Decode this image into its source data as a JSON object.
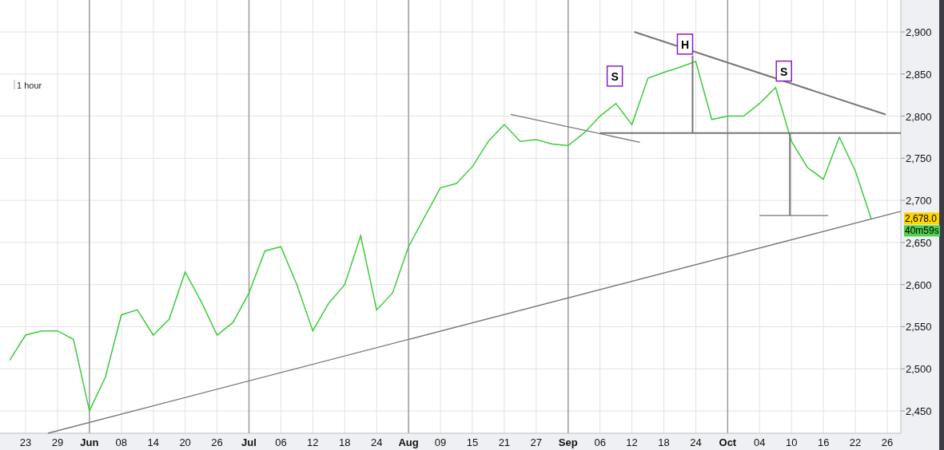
{
  "chart_title": "1 hour",
  "last_price": "2,678.0",
  "countdown": "40m59s",
  "chart_data": {
    "type": "line",
    "grid": true,
    "ylim": [
      2423.5,
      2937.9
    ],
    "yticks": [
      {
        "value": 2450,
        "label": "2,450"
      },
      {
        "value": 2500,
        "label": "2,500"
      },
      {
        "value": 2550,
        "label": "2,550"
      },
      {
        "value": 2600,
        "label": "2,600"
      },
      {
        "value": 2650,
        "label": "2,650"
      },
      {
        "value": 2700,
        "label": "2,700"
      },
      {
        "value": 2750,
        "label": "2,750"
      },
      {
        "value": 2800,
        "label": "2,800"
      },
      {
        "value": 2850,
        "label": "2,850"
      },
      {
        "value": 2900,
        "label": "2,900"
      }
    ],
    "categories": [
      null,
      "23",
      null,
      "29",
      null,
      "Jun",
      null,
      "08",
      null,
      "14",
      null,
      "20",
      null,
      "26",
      null,
      "Jul",
      null,
      "06",
      null,
      "12",
      null,
      "18",
      null,
      "24",
      null,
      "Aug",
      null,
      "09",
      null,
      "15",
      null,
      "21",
      null,
      "27",
      null,
      "Sep",
      null,
      "06",
      null,
      "12",
      null,
      "18",
      null,
      "24",
      null,
      "Oct",
      null,
      "04",
      null,
      "10",
      null,
      "16",
      null,
      "22",
      null,
      "26"
    ],
    "series": [
      {
        "color": "#3ccc3c",
        "values": [
          2510,
          2540,
          2545,
          2545,
          2535,
          2450,
          2490,
          2564,
          2570,
          2540,
          2559,
          2615,
          2580,
          2540,
          2555,
          2590,
          2640,
          2645,
          2600,
          2545,
          2578,
          2600,
          2658,
          2570,
          2590,
          2645,
          2680,
          2715,
          2720,
          2740,
          2770,
          2790,
          2770,
          2772,
          2767,
          2765,
          2780,
          2800,
          2815,
          2790,
          2845,
          2852,
          2858,
          2865,
          2796,
          2800,
          2800,
          2815,
          2834,
          2770,
          2739,
          2725,
          2775,
          2735,
          2678,
          null
        ]
      }
    ]
  },
  "pattern_labels": [
    "S",
    "H",
    "S"
  ]
}
